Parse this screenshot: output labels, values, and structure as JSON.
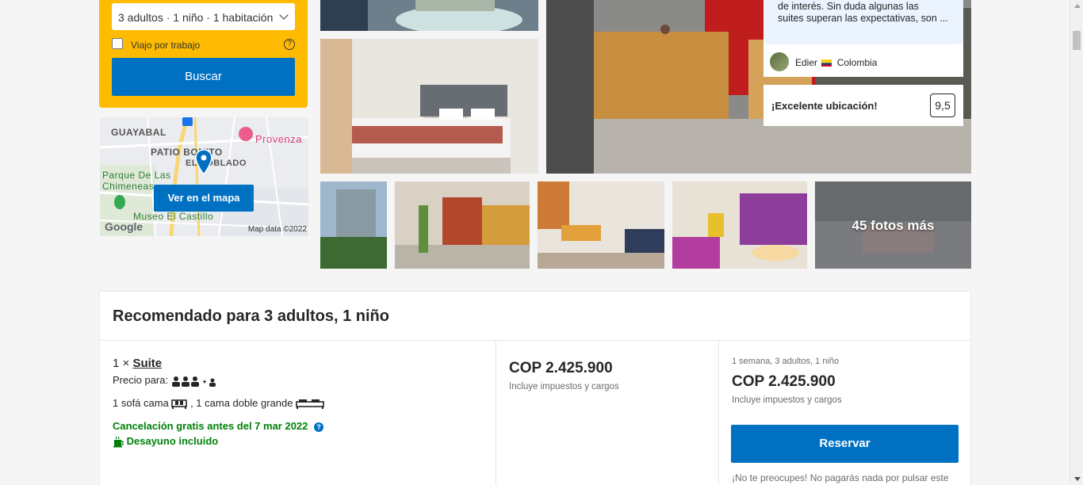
{
  "search": {
    "occupancy": "3 adultos · 1 niño · 1 habitación",
    "work_trip_label": "Viajo por trabajo",
    "help": "?",
    "button": "Buscar"
  },
  "map": {
    "labels": {
      "guayabal": "GUAYABAL",
      "patio_bonito": "PATIO BONITO",
      "poblado": "EL POBLADO",
      "provenza": "Provenza",
      "parque": "Parque De Las",
      "chimeneas": "Chimeneas",
      "museo": "Museo El Castillo",
      "google": "Google",
      "copyright": "Map data ©2022"
    },
    "button": "Ver en el mapa"
  },
  "gallery": {
    "more_photos": "45 fotos más"
  },
  "review": {
    "text_line1": "de interés. Sin duda algunas las",
    "text_line2": "suites superan las expectativas, son ...",
    "author": "Edier",
    "country": "Colombia"
  },
  "score": {
    "label": "¡Excelente ubicación!",
    "value": "9,5"
  },
  "recommendation": {
    "title": "Recomendado para 3 adultos, 1 niño",
    "room_qty": "1 ×",
    "room_name": "Suite",
    "price_for_label": "Precio para:",
    "beds_part1": "1 sofá cama",
    "beds_part2": ", 1 cama doble grande",
    "cancellation": "Cancelación gratis antes del 7 mar 2022",
    "breakfast": "Desayuno incluido",
    "price": "COP 2.425.900",
    "taxes": "Incluye impuestos y cargos",
    "stay_summary": "1 semana, 3 adultos, 1 niño",
    "total_price": "COP 2.425.900",
    "total_taxes": "Incluye impuestos y cargos",
    "book_button": "Reservar",
    "no_charge_note": "¡No te preocupes! No pagarás nada por pulsar este"
  },
  "colors": {
    "brand_blue": "#0071c2",
    "search_yellow": "#febb02",
    "success_green": "#008009"
  }
}
